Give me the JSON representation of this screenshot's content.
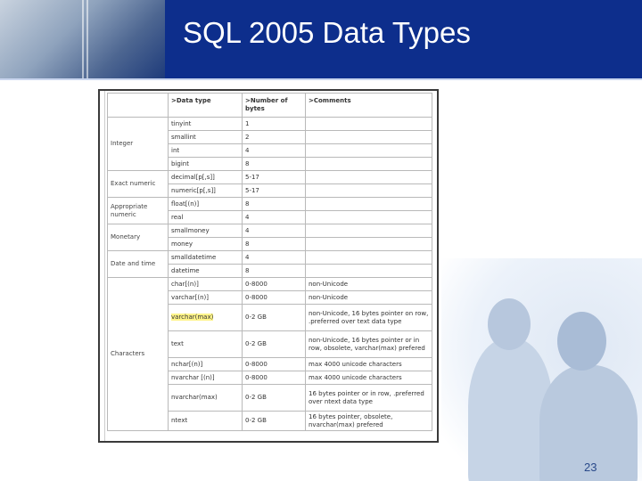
{
  "slide": {
    "title": "SQL 2005 Data Types",
    "number": "23"
  },
  "table": {
    "headers": [
      ">Data type",
      ">Number of bytes",
      ">Comments"
    ],
    "rows": [
      {
        "category": "Integer",
        "type": "tinyint",
        "bytes": "1",
        "comment": ""
      },
      {
        "category": "",
        "type": "smallint",
        "bytes": "2",
        "comment": ""
      },
      {
        "category": "",
        "type": "int",
        "bytes": "4",
        "comment": ""
      },
      {
        "category": "",
        "type": "bigint",
        "bytes": "8",
        "comment": ""
      },
      {
        "category": "Exact numeric",
        "type": "decimal[p[,s]]",
        "bytes": "5-17",
        "comment": ""
      },
      {
        "category": "",
        "type": "numeric[p[,s]]",
        "bytes": "5-17",
        "comment": ""
      },
      {
        "category": "Appropriate numeric",
        "type": "float[(n)]",
        "bytes": "8",
        "comment": ""
      },
      {
        "category": "",
        "type": "real",
        "bytes": "4",
        "comment": ""
      },
      {
        "category": "Monetary",
        "type": "smallmoney",
        "bytes": "4",
        "comment": ""
      },
      {
        "category": "",
        "type": "money",
        "bytes": "8",
        "comment": ""
      },
      {
        "category": "Date and time",
        "type": "smalldatetime",
        "bytes": "4",
        "comment": ""
      },
      {
        "category": "",
        "type": "datetime",
        "bytes": "8",
        "comment": ""
      },
      {
        "category": "Characters",
        "type": "char[(n)]",
        "bytes": "0-8000",
        "comment": "non-Unicode"
      },
      {
        "category": "",
        "type": "varchar[(n)]",
        "bytes": "0-8000",
        "comment": "non-Unicode"
      },
      {
        "category": "",
        "type": "varchar(max)",
        "bytes": "0-2 GB",
        "comment": "non-Unicode, 16 bytes pointer on row, .preferred over text data type",
        "highlight": true
      },
      {
        "category": "",
        "type": "text",
        "bytes": "0-2 GB",
        "comment": "non-Unicode, 16 bytes pointer or in row, obsolete, varchar(max) prefered"
      },
      {
        "category": "",
        "type": "nchar[(n)]",
        "bytes": "0-8000",
        "comment": "max 4000 unicode characters"
      },
      {
        "category": "",
        "type": "nvarchar [(n)]",
        "bytes": "0-8000",
        "comment": "max 4000 unicode characters"
      },
      {
        "category": "",
        "type": "nvarchar(max)",
        "bytes": "0-2 GB",
        "comment": "16 bytes pointer or in row, .preferred over ntext data type"
      },
      {
        "category": "",
        "type": "ntext",
        "bytes": "0-2 GB",
        "comment": "16 bytes pointer, obsolete, nvarchar(max) prefered"
      }
    ]
  }
}
